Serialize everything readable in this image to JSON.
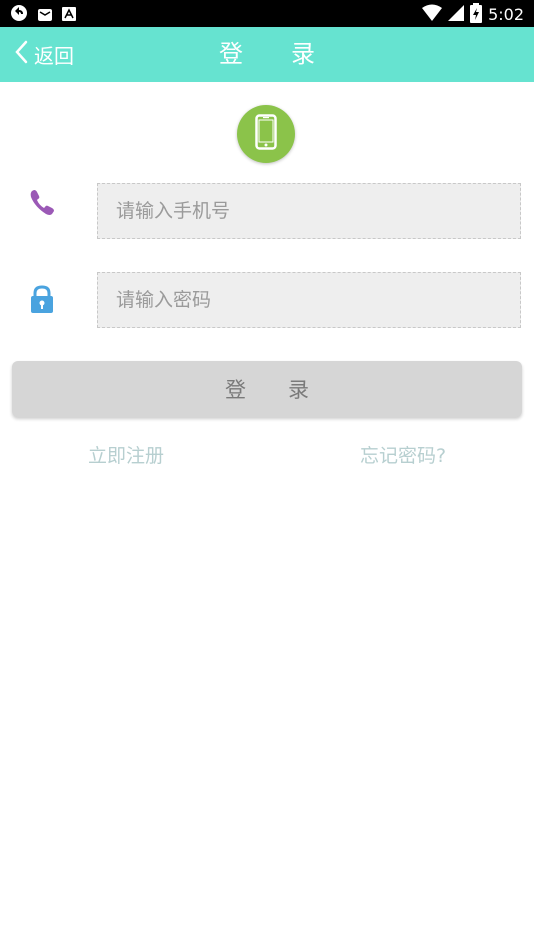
{
  "status_bar": {
    "time": "5:02",
    "icons": [
      "sync-icon",
      "mail-icon",
      "text-icon",
      "wifi-icon",
      "signal-icon",
      "battery-icon"
    ]
  },
  "header": {
    "back_label": "返回",
    "title": "登　　录",
    "background": "#66e3d0"
  },
  "logo": {
    "icon": "phone-icon",
    "color": "#8bc34a"
  },
  "form": {
    "phone": {
      "placeholder": "请输入手机号",
      "value": "",
      "icon": "phone-handset-icon",
      "icon_color": "#9b59b6"
    },
    "password": {
      "placeholder": "请输入密码",
      "value": "",
      "icon": "lock-icon",
      "icon_color": "#4aa3df"
    },
    "submit_label": "登　　录"
  },
  "links": {
    "register": "立即注册",
    "forgot_password": "忘记密码?"
  }
}
